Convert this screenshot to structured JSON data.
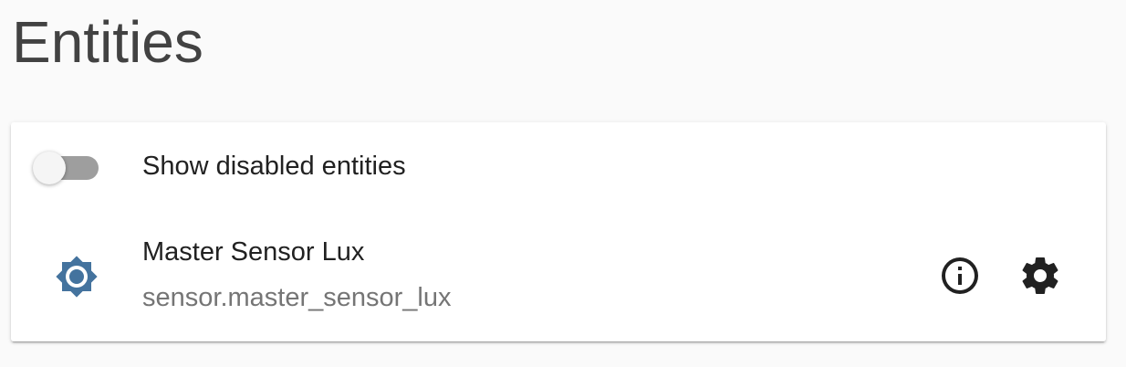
{
  "page": {
    "title": "Entities"
  },
  "toggle": {
    "label": "Show disabled entities",
    "checked": false
  },
  "entity": {
    "name": "Master Sensor Lux",
    "id": "sensor.master_sensor_lux",
    "icon": "brightness-icon",
    "icon_color": "#44739e"
  },
  "actions": {
    "info_icon": "info-icon",
    "settings_icon": "gear-icon"
  },
  "colors": {
    "background": "#fafafa",
    "card": "#ffffff",
    "title": "#424242",
    "primary_text": "#212121",
    "secondary_text": "#757575",
    "toggle_track": "#9e9e9e"
  }
}
